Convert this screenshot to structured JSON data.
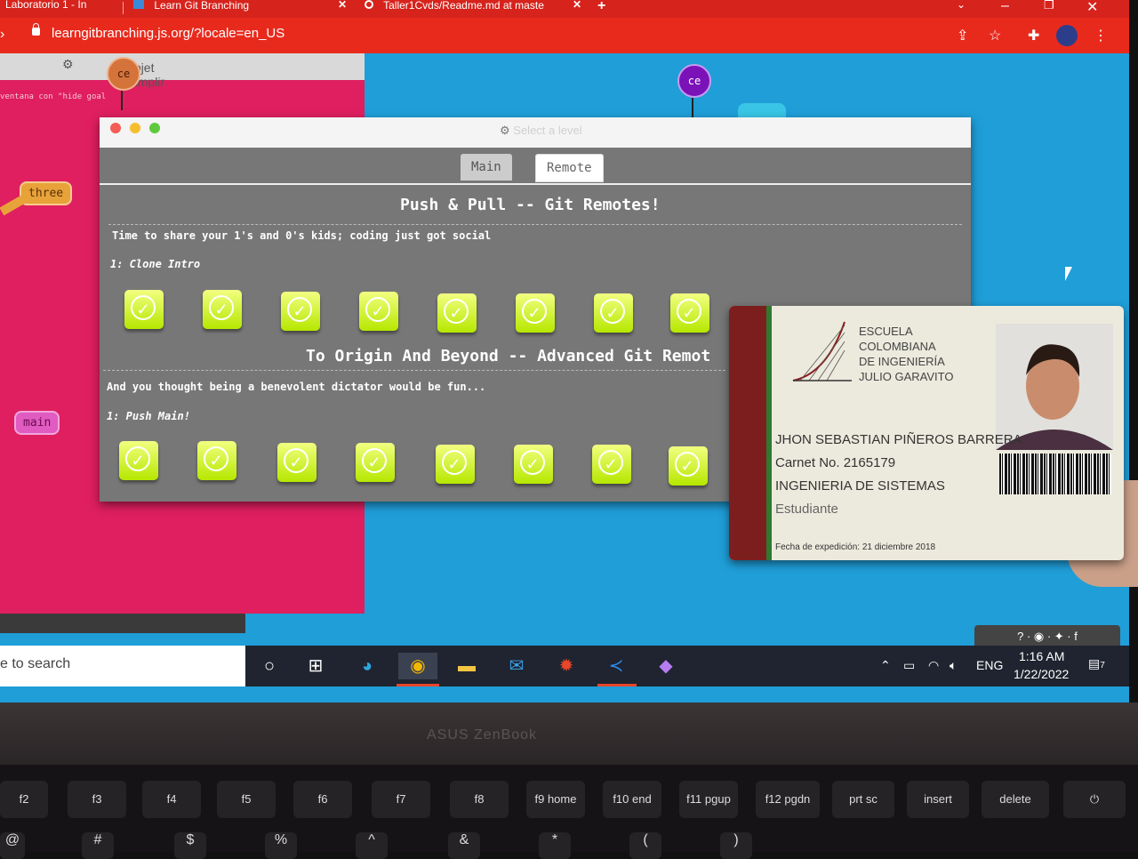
{
  "browser": {
    "tabs": [
      {
        "title": "Laboratorio 1 - In",
        "active": false
      },
      {
        "title": "Learn Git Branching",
        "active": true
      },
      {
        "title": "Taller1Cvds/Readme.md at maste",
        "active": false
      }
    ],
    "new_tab": "+",
    "url": "learngitbranching.js.org/?locale=en_US"
  },
  "page": {
    "goal_header": "Objet  cumplir",
    "hint_text": "ventana con \"hide goal",
    "nodes": [
      {
        "label": "ce",
        "color": "#d4733a"
      },
      {
        "label": "ce",
        "color": "#7b12b8"
      }
    ],
    "branches": [
      {
        "label": "three",
        "color": "#e8a23a"
      },
      {
        "label": "main",
        "color": "#e05cc0"
      }
    ]
  },
  "modal": {
    "title": "Select a level",
    "tabs": [
      "Main",
      "Remote"
    ],
    "active_tab": "Remote",
    "sections": [
      {
        "heading": "Push & Pull -- Git Remotes!",
        "description": "Time to share your 1's and 0's kids; coding just got social",
        "sequence_label": "1: Clone Intro",
        "levels_completed": 8
      },
      {
        "heading": "To Origin And Beyond -- Advanced Git Remot",
        "description": "And you thought being a benevolent dictator would be fun...",
        "sequence_label": "1: Push Main!",
        "levels_completed": 8
      }
    ]
  },
  "id_card": {
    "school_lines": [
      "Escuela",
      "Colombiana",
      "de Ingeniería",
      "Julio Garavito"
    ],
    "name": "JHON SEBASTIAN PIÑEROS BARRERA",
    "carnet": "Carnet No. 2165179",
    "program": "INGENIERIA DE SISTEMAS",
    "role": "Estudiante",
    "issued": "Fecha de expedición: 21 diciembre 2018"
  },
  "taskbar": {
    "search_text": "e to search",
    "language": "ENG",
    "time": "1:16 AM",
    "date": "1/22/2022",
    "notifications": "7"
  },
  "social_bar": "? · ◉ · ✦ · f",
  "laptop": {
    "brand": "ASUS ZenBook",
    "fn_keys": [
      "f2",
      "f3",
      "f4",
      "f5",
      "f6",
      "f7",
      "f8",
      "f9 home",
      "f10 end",
      "f11 pgup",
      "f12 pgdn",
      "prt sc",
      "insert",
      "delete"
    ],
    "number_keys": [
      "@",
      "#",
      "$",
      "%",
      "^",
      "&",
      "*",
      "(",
      ")"
    ]
  }
}
